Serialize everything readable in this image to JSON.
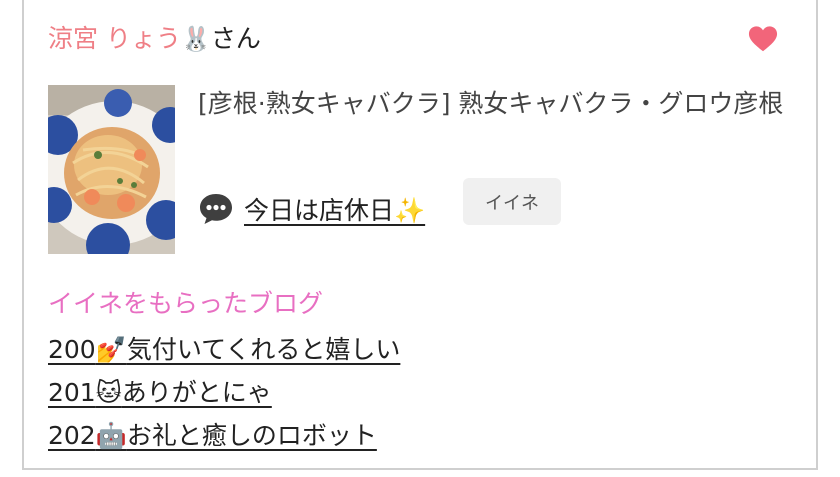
{
  "header": {
    "name": "涼宮 りょう",
    "emoji": "🐰",
    "honorific": "さん"
  },
  "post": {
    "shop": "[彦根·熟女キャバクラ]  熟女キャバクラ・グロウ彦根",
    "title": "今日は店休日✨",
    "like_label": "イイネ"
  },
  "liked_section": {
    "title": "イイネをもらったブログ",
    "items": [
      {
        "number": "200",
        "emoji": "💅",
        "text": "気付いてくれると嬉しい"
      },
      {
        "number": "201",
        "emoji": "🐱",
        "text": "ありがとにゃ"
      },
      {
        "number": "202",
        "emoji": "🤖",
        "text": "お礼と癒しのロボット"
      }
    ]
  },
  "colors": {
    "name": "#ef7f86",
    "heart": "#f2657a",
    "section_title": "#e86fc2"
  },
  "icons": [
    "heart-icon",
    "speech-bubble-icon",
    "food-photo"
  ]
}
